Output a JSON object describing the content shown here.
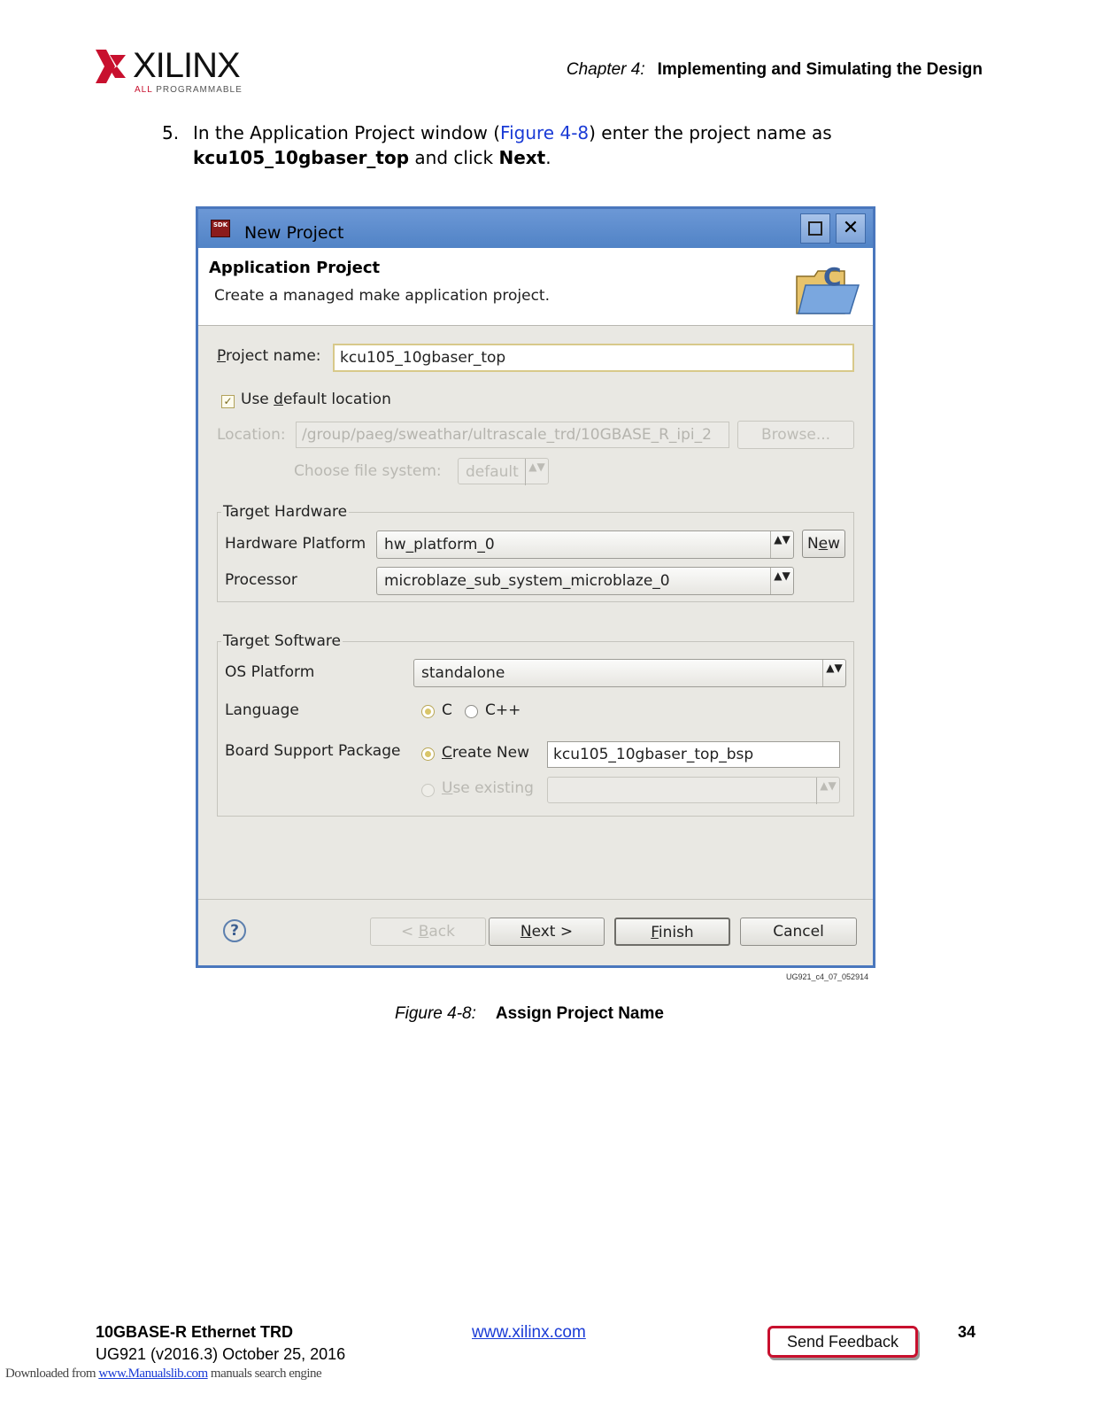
{
  "header": {
    "logo_word": "XILINX",
    "logo_tag_prefix": "ALL",
    "logo_tag_rest": " PROGRAMMABLE",
    "chapter_number": "Chapter 4:",
    "chapter_title": "Implementing and Simulating the Design"
  },
  "step": {
    "number": "5.",
    "text_1": "In the Application Project window (",
    "figure_link": "Figure 4-8",
    "text_2": ") enter the project name as ",
    "project_name": "kcu105_10gbaser_top",
    "text_3": " and click ",
    "next_word": "Next",
    "text_4": "."
  },
  "dialog": {
    "icon_label": "SDK",
    "title": "New Project",
    "maximize_icon": "maximize-icon",
    "close_icon": "close-icon",
    "close_glyph": "✕",
    "banner_title": "Application Project",
    "banner_description": "Create a managed make application project.",
    "project_name_label": "Project name:",
    "project_name_value": "kcu105_10gbaser_top",
    "use_default_location_label": "Use default location",
    "use_default_location_checked": true,
    "check_glyph": "✓",
    "location_label": "Location:",
    "location_value": "/group/paeg/sweathar/ultrascale_trd/10GBASE_R_ipi_2",
    "browse_label": "Browse...",
    "file_system_label": "Choose file system:",
    "file_system_value": "default",
    "target_hardware": {
      "group_title": "Target Hardware",
      "hardware_platform_label": "Hardware Platform",
      "hardware_platform_value": "hw_platform_0",
      "new_button_label": "New",
      "processor_label": "Processor",
      "processor_value": "microblaze_sub_system_microblaze_0"
    },
    "target_software": {
      "group_title": "Target Software",
      "os_platform_label": "OS Platform",
      "os_platform_value": "standalone",
      "language_label": "Language",
      "language_c": "C",
      "language_cpp": "C++",
      "language_selected": "C",
      "bsp_label": "Board Support Package",
      "bsp_create_new_label": "Create New",
      "bsp_create_new_value": "kcu105_10gbaser_top_bsp",
      "bsp_use_existing_label": "Use existing",
      "bsp_selected": "Create New"
    },
    "combo_arrows": "▲▼",
    "help_glyph": "?",
    "back_label": "< Back",
    "next_label": "Next >",
    "finish_label": "Finish",
    "cancel_label": "Cancel"
  },
  "figure": {
    "id": "UG921_c4_07_052914",
    "caption_number": "Figure 4-8:",
    "caption_title": "Assign Project Name"
  },
  "footer": {
    "doc_title": "10GBASE-R Ethernet TRD",
    "doc_version": "UG921 (v2016.3) October 25, 2016",
    "url": "www.xilinx.com",
    "feedback_label": "Send Feedback",
    "page_number": "34",
    "download_prefix": "Downloaded from ",
    "download_link": "www.Manualslib.com",
    "download_suffix": "  manuals search engine"
  },
  "colors": {
    "brand_red": "#c8102e",
    "title_bar_blue": "#5b8bcc",
    "link_blue": "#1a3bd6"
  }
}
